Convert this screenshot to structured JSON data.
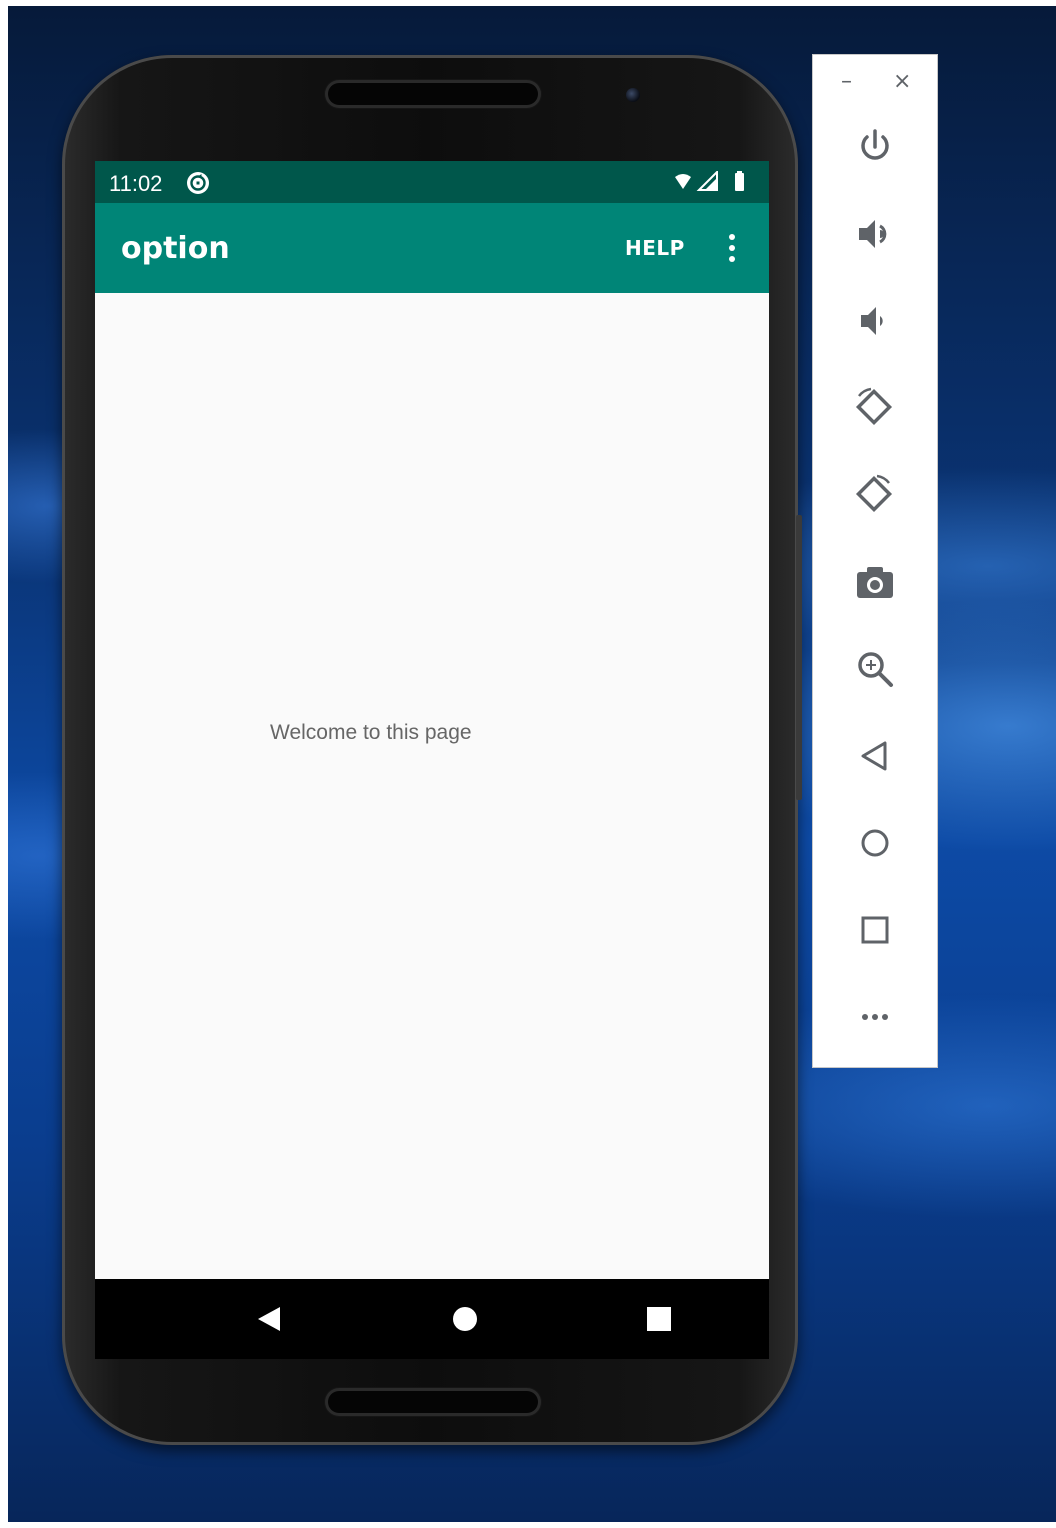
{
  "status_bar": {
    "time": "11:02"
  },
  "app_bar": {
    "title": "option",
    "help_action": "HELP"
  },
  "content": {
    "welcome_text": "Welcome to this page"
  },
  "colors": {
    "status_bar": "#00574b",
    "app_bar": "#008577",
    "screen_background": "#fafafa",
    "toolbar_icon": "#5f6368"
  },
  "emulator_toolbar": {
    "window_controls": [
      "minimize",
      "close"
    ],
    "tools": [
      "power-icon",
      "volume-up-icon",
      "volume-down-icon",
      "rotate-left-icon",
      "rotate-right-icon",
      "camera-icon",
      "zoom-icon",
      "back-icon",
      "home-icon",
      "overview-icon",
      "more-icon"
    ]
  }
}
